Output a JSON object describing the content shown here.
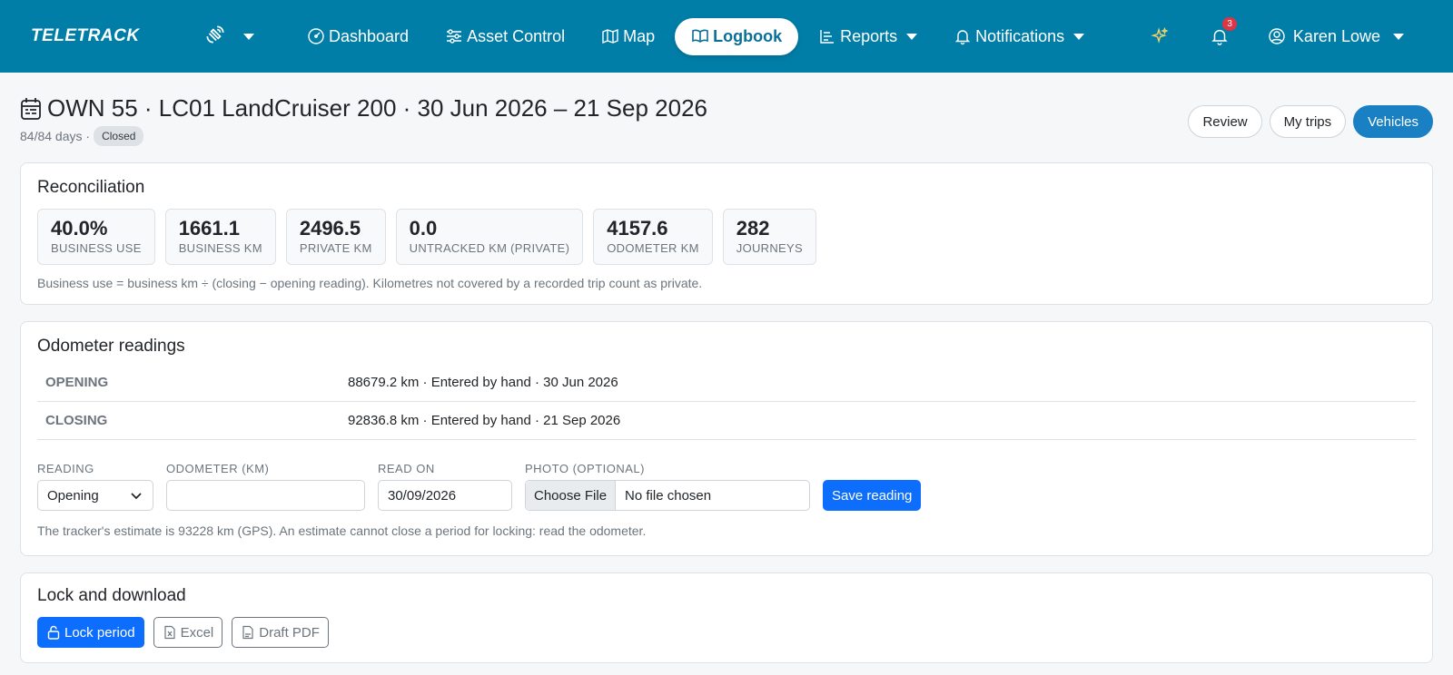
{
  "nav": {
    "brand": "TELETRACK",
    "items": [
      {
        "label": "Dashboard",
        "icon": "speedometer-icon"
      },
      {
        "label": "Asset Control",
        "icon": "sliders-icon"
      },
      {
        "label": "Map",
        "icon": "map-icon"
      },
      {
        "label": "Logbook",
        "icon": "book-icon",
        "active": true
      },
      {
        "label": "Reports",
        "icon": "chart-icon"
      },
      {
        "label": "Notifications",
        "icon": "bell-icon"
      }
    ],
    "notification_count": "3",
    "user": "Karen Lowe"
  },
  "header": {
    "title": "OWN 55 · LC01 LandCruiser 200 · 30 Jun 2026 – 21 Sep 2026",
    "days": "84/84 days ·",
    "status": "Closed",
    "buttons": {
      "review": "Review",
      "my_trips": "My trips",
      "vehicles": "Vehicles"
    }
  },
  "reconciliation": {
    "title": "Reconciliation",
    "stats": [
      {
        "value": "40.0%",
        "label": "BUSINESS USE"
      },
      {
        "value": "1661.1",
        "label": "BUSINESS KM"
      },
      {
        "value": "2496.5",
        "label": "PRIVATE KM"
      },
      {
        "value": "0.0",
        "label": "UNTRACKED KM (PRIVATE)"
      },
      {
        "value": "4157.6",
        "label": "ODOMETER KM"
      },
      {
        "value": "282",
        "label": "JOURNEYS"
      }
    ],
    "note": "Business use = business km ÷ (closing − opening reading). Kilometres not covered by a recorded trip count as private."
  },
  "odometer": {
    "title": "Odometer readings",
    "rows": [
      {
        "key": "OPENING",
        "detail": "88679.2 km · Entered by hand · 30 Jun 2026"
      },
      {
        "key": "CLOSING",
        "detail": "92836.8 km · Entered by hand · 21 Sep 2026"
      }
    ],
    "form": {
      "reading_label": "READING",
      "reading_value": "Opening",
      "odometer_label": "ODOMETER (KM)",
      "odometer_value": "",
      "read_on_label": "READ ON",
      "read_on_value": "30/09/2026",
      "photo_label": "PHOTO (OPTIONAL)",
      "choose_file": "Choose File",
      "no_file": "No file chosen",
      "save": "Save reading"
    },
    "hint": "The tracker's estimate is 93228 km (GPS). An estimate cannot close a period for locking: read the odometer."
  },
  "lock": {
    "title": "Lock and download",
    "lock_btn": "Lock period",
    "excel_btn": "Excel",
    "pdf_btn": "Draft PDF"
  }
}
